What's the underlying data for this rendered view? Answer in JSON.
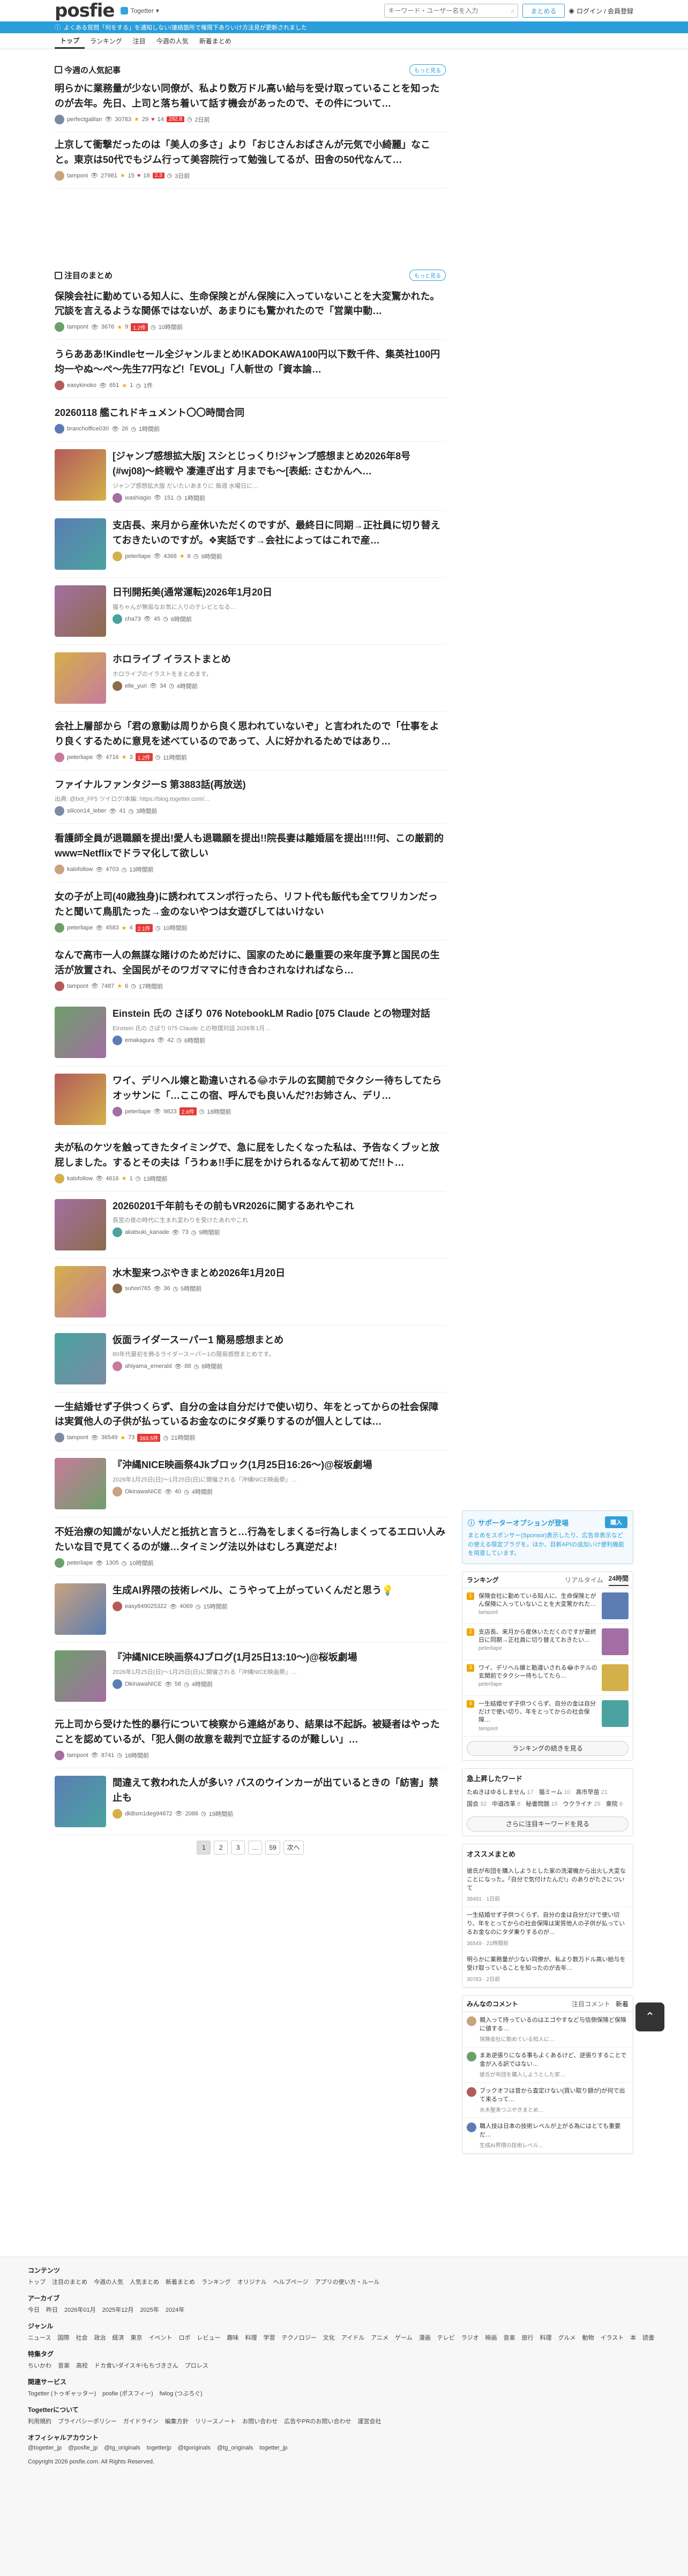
{
  "header": {
    "logo": "posfie",
    "sublogo": "Togetter",
    "search_placeholder": "キーワード・ユーザー名を入力",
    "make_label": "まとめる",
    "login_label": "ログイン / 会員登録"
  },
  "notice": "よくある質問「何をする」を通知しない/連絡箇所で権限下ありいけ方法見が更新されました",
  "tabs": [
    "トップ",
    "ランキング",
    "注目",
    "今週の人気",
    "新着まとめ"
  ],
  "hot": {
    "heading": "今週の人気記事",
    "more": "もっと見る",
    "items": [
      {
        "title": "明らかに業務量が少ない同僚が、私より数万ドル高い給与を受け取っていることを知ったのが去年。先日、上司と落ち着いて話す機会があったので、その件について…",
        "user": "perfectgalilan",
        "views": "30783",
        "stars": "29",
        "hearts": "14",
        "badge": "292.8",
        "comments": "2日前"
      },
      {
        "title": "上京して衝撃だったのは「美人の多さ」より「おじさんおばさんが元気で小綺麗」なこと。東京は50代でもジム行って美容院行って勉強してるが、田舎の50代なんて…",
        "user": "tamponi",
        "views": "27981",
        "stars": "15",
        "hearts": "18",
        "badge": "2.3",
        "comments": "3日前"
      }
    ]
  },
  "featured": {
    "heading": "注目のまとめ",
    "more": "もっと見る",
    "items": [
      {
        "title": "保険会社に勤めている知人に、生命保険とがん保険に入っていないことを大変驚かれた。冗談を言えるような関係ではないが、あまりにも驚かれたので「営業中動…",
        "user": "tampont",
        "views": "3676",
        "stars": "9",
        "badge": "1.2件",
        "comments": "10時間前",
        "thumb": false
      },
      {
        "title": "うらあああ!Kindleセール全ジャンルまとめ!KADOKAWA100円以下数千件、集英社100円均一やぬ〜ぺ〜先生77円など!「EVOL」「人斬世の「資本論…",
        "user": "easykinoko",
        "views": "651",
        "stars": "1",
        "badge": "",
        "comments": "1件",
        "thumb": false
      },
      {
        "title": "20260118 艦これドキュメント〇〇時間合同",
        "user": "branchoffice030",
        "views": "26",
        "stars": "",
        "badge": "",
        "comments": "1時間前",
        "thumb": false
      },
      {
        "title": "[ジャンプ感想拡大版] スシとじっくり!ジャンプ感想まとめ2026年8号(#wj08)〜終戦や 凄連ぎ出す 月までも〜[表紙: さむかんへ…",
        "desc": "ジャンプ感想拡大版 だいたいあまりに 毎週 水曜日に…",
        "user": "washiagio",
        "views": "151",
        "stars": "",
        "badge": "",
        "comments": "1時間前",
        "thumb": true
      },
      {
        "title": "支店長、来月から産休いただくのですが、最終日に同期→正社員に切り替えておきたいのですが。❖実話です→会社によってはこれで産…",
        "user": "peterliape",
        "views": "4368",
        "stars": "6",
        "badge": "",
        "comments": "9時間前",
        "thumb": true
      },
      {
        "title": "日刊開拓美(通常運転)2026年1月20日",
        "desc": "猫ちゃんが無垢なお気に入りのテレビとなる…",
        "user": "cha73",
        "views": "45",
        "stars": "",
        "badge": "",
        "comments": "6時間前",
        "thumb": true
      },
      {
        "title": "ホロライブ イラストまとめ",
        "desc": "ホロライブのイラストをまとめます。",
        "user": "elle_yuri",
        "views": "34",
        "stars": "",
        "badge": "",
        "comments": "4時間前",
        "thumb": true
      },
      {
        "title": "会社上層部から「君の意動は周りから良く思われていないぞ」と言われたので「仕事をより良くするために意見を述べているのであって、人に好かれるためではあり…",
        "user": "peterliape",
        "views": "4716",
        "stars": "3",
        "badge": "1.2件",
        "comments": "11時間前",
        "thumb": false
      },
      {
        "title": "ファイナルファンタジーS 第3883話(再放送)",
        "desc": "出典: @bot_FF5 ツイログ/本編: https://blog.togetter.com/…",
        "user": "silicon14_leber",
        "views": "41",
        "stars": "",
        "badge": "",
        "comments": "3時間前",
        "thumb": false
      },
      {
        "title": "看護師全員が退職願を提出!愛人も退職願を提出!!院長妻は離婚届を提出!!!!何、この厳罰的www=Netflixでドラマ化して欲しい",
        "user": "kalofollow",
        "views": "4703",
        "stars": "",
        "badge": "",
        "comments": "13時間前",
        "thumb": false
      },
      {
        "title": "女の子が上司(40歳独身)に誘われてスンポ行ったら、リフト代も飯代も全てワリカンだったと聞いて鳥肌たった→金のないやつは女遊びしてはいけない",
        "user": "peterliape",
        "views": "4583",
        "stars": "4",
        "badge": "2.1件",
        "comments": "10時間前",
        "thumb": false
      },
      {
        "title": "なんで高市一人の無謀な賭けのためだけに、国家のために最重要の来年度予算と国民の生活が放置され、全国民がそのワガママに付き合わされなければなら…",
        "user": "tampont",
        "views": "7487",
        "stars": "6",
        "badge": "",
        "comments": "17時間前",
        "thumb": false
      },
      {
        "title": "Einstein 氏の さぼり 076 NotebookLM Radio [075 Claude との物理対話",
        "desc": "Einstein 氏の さぼり 075 Claude との物理対話 2026年1月…",
        "user": "emakagura",
        "views": "42",
        "stars": "",
        "badge": "",
        "comments": "6時間前",
        "thumb": true
      },
      {
        "title": "ワイ、デリヘル嬢と勘違いされる😂ホテルの玄関前でタクシー待ちしてたらオッサンに「…ここの宿、呼んでも良いんだ?!お姉さん、デリ…",
        "user": "peterliape",
        "views": "9823",
        "stars": "",
        "badge": "2.6件",
        "comments": "18時間前",
        "thumb": true
      },
      {
        "title": "夫が私のケツを触ってきたタイミングで、急に屁をしたくなった私は、予告なくブッと放屁しました。するとその夫は「うわぁ!!手に屁をかけられるなんて初めてだ!!ト…",
        "user": "kalofollow",
        "views": "4616",
        "stars": "1",
        "badge": "",
        "comments": "13時間前",
        "thumb": false
      },
      {
        "title": "20260201千年前もその前もVR2026に関するあれやこれ",
        "desc": "長宮の夜の時代に生まれ変わりを受けたあれやこれ",
        "user": "akatsuki_kanade",
        "views": "73",
        "stars": "",
        "badge": "",
        "comments": "9時間前",
        "thumb": true
      },
      {
        "title": "水木聖来つぶやきまとめ2026年1月20日",
        "desc": "",
        "user": "suhori765",
        "views": "36",
        "stars": "",
        "badge": "",
        "comments": "5時間前",
        "thumb": true
      },
      {
        "title": "仮面ライダースーパー1 簡易感想まとめ",
        "desc": "80年代最初を飾るライダースーパー1の簡易感想まとめです。",
        "user": "ahiyama_emerald",
        "views": "88",
        "stars": "",
        "badge": "",
        "comments": "8時間前",
        "thumb": true
      },
      {
        "title": "一生結婚せず子供つくらず、自分の金は自分だけで使い切り、年をとってからの社会保障は実質他人の子供が払っているお金なのにタダ乗りするのが個人としては…",
        "user": "tampont",
        "views": "36549",
        "stars": "73",
        "badge": "393.5件",
        "comments": "21時間前",
        "thumb": false
      },
      {
        "title": "『沖縄NICE映画祭4Jkブロック(1月25日16:26〜)@桜坂劇場",
        "desc": "2026年1月25日(日)〜1月25日(日)に開催される「沖縄NICE映画祭」…",
        "user": "OkinawaNICE",
        "views": "40",
        "stars": "",
        "badge": "",
        "comments": "4時間前",
        "thumb": true
      },
      {
        "title": "不妊治療の知識がない人だと抵抗と言うと…行為をしまくる=行為しまくってるエロい人みたいな目で見てくるのが嫌…タイミング法以外はむしろ真逆だよ!",
        "user": "peterliape",
        "views": "1305",
        "stars": "",
        "badge": "",
        "comments": "10時間前",
        "thumb": false
      },
      {
        "title": "生成AI界隈の技術レベル、こうやって上がっていくんだと思う💡",
        "desc": "",
        "user": "easy849025322",
        "views": "4069",
        "stars": "",
        "badge": "",
        "comments": "15時間前",
        "thumb": true
      },
      {
        "title": "『沖縄NICE映画祭4Jブログ(1月25日13:10〜)@桜坂劇場",
        "desc": "2026年1月25日(日)〜1月25日(日)に開催される「沖縄NICE映画祭」…",
        "user": "OkinawaNICE",
        "views": "58",
        "stars": "",
        "badge": "",
        "comments": "4時間前",
        "thumb": true
      },
      {
        "title": "元上司から受けた性的暴行について検察から連絡があり、結果は不起訴。被疑者はやったことを認めているが、「犯人側の故意を裁判で立証するのが難しい」…",
        "user": "tampont",
        "views": "8741",
        "stars": "",
        "badge": "",
        "comments": "18時間前",
        "thumb": false
      },
      {
        "title": "間違えて救われた人が多い? バスのウインカーが出ているときの「紡害」禁止も",
        "desc": "",
        "user": "dkBsm1deg94672",
        "views": "2086",
        "stars": "",
        "badge": "",
        "comments": "19時間前",
        "thumb": true
      }
    ]
  },
  "pager": [
    "1",
    "2",
    "3",
    "…",
    "59",
    "次へ"
  ],
  "sidebar": {
    "sponsor_title": "サポーターオプションが登場",
    "sponsor_join": "購入",
    "sponsor_text": "まとめをスポンサー(Sponsor)表示したり、広告非表示などの使える限定ブラグを。ほか、目新APIの追加いけ便利機能を用意しています。",
    "ranking_label": "ランキング",
    "ranking_tab1": "リアルタイム",
    "ranking_tab2": "24時間",
    "ranking": [
      {
        "n": "1",
        "t": "保険会社に勤めている知人に、生命保険とがん保険に入っていないことを大変驚かれた…",
        "sub": "tampont"
      },
      {
        "n": "2",
        "t": "支店長、来月から産休いただくのですが最終日に同期→正社員に切り替えておきたい…",
        "sub": "peterliape"
      },
      {
        "n": "3",
        "t": "ワイ、デリヘル嬢と勘違いされる😂ホテルの玄関前でタクシー待ちしてたら…",
        "sub": "peterliape"
      },
      {
        "n": "4",
        "t": "一生結婚せず子供つくらず、自分の金は自分だけで使い切り、年をとってからの社会保障…",
        "sub": "tampont"
      }
    ],
    "ranking_more": "ランキングの続きを見る",
    "kw_title": "急上昇したワード",
    "keywords": [
      {
        "w": "たぬきはゆるしません",
        "c": "17"
      },
      {
        "w": "猫ミーム",
        "c": "10"
      },
      {
        "w": "高市早苗",
        "c": "21"
      },
      {
        "w": "国会",
        "c": "32"
      },
      {
        "w": "中道改革",
        "c": "8"
      },
      {
        "w": "秘書問題",
        "c": "15"
      },
      {
        "w": "ウクライナ",
        "c": "25"
      },
      {
        "w": "衆院",
        "c": "9"
      }
    ],
    "kw_more": "さらに注目キーワードを見る",
    "reco_title": "オススメまとめ",
    "recos": [
      {
        "t": "彼氏が布団を購入しようとした家の洗濯機から出火し大変なことになった。「自分で気付けたんだ!」のありがたさについて",
        "sub": "39491 · 1日前"
      },
      {
        "t": "一生結婚せず子供つくらず、自分の金は自分だけで使い切り、年をとってからの社会保障は実質他人の子供が払っているお金なのにタダ乗りするのが…",
        "sub": "36549 · 21時間前"
      },
      {
        "t": "明らかに業務量が少ない同僚が、私より数万ドル高い給与を受け取っていることを知ったのが去年…",
        "sub": "30783 · 2日前"
      }
    ],
    "comment_title": "みんなのコメント",
    "comment_tab1": "注目コメント",
    "comment_tab2": "新着",
    "comments": [
      {
        "t": "親入って持っているのはエゴやすなど与信側保険ど保険に値する…",
        "sub": "保険会社に勤めている知人に…"
      },
      {
        "t": "まあ逆張りになる事もよくあるけど、逆張りすることで金が入る訳ではない…",
        "sub": "彼氏が布団を購入しようとした家…"
      },
      {
        "t": "ブックオフは昔から査定けない(買い取り額が)が何で出て来るって…",
        "sub": "水木聖来つぶやきまとめ…"
      },
      {
        "t": "職人技は日本の技術レベルが上がる為にはとても重要だ…",
        "sub": "生成AI界隈の技術レベル…"
      }
    ]
  },
  "footer": {
    "sections": [
      {
        "h": "コンテンツ",
        "links": [
          "トップ",
          "注目のまとめ",
          "今週の人気",
          "人気まとめ",
          "新着まとめ",
          "ランキング",
          "オリジナル",
          "ヘルプページ",
          "アプリの使い方・ルール"
        ]
      },
      {
        "h": "アーカイブ",
        "links": [
          "今日",
          "昨日",
          "2026年01月",
          "2025年12月",
          "2025年",
          "2024年"
        ]
      },
      {
        "h": "ジャンル",
        "links": [
          "ニュース",
          "国際",
          "社会",
          "政治",
          "経済",
          "東京",
          "イベント",
          "ロボ",
          "レビュー",
          "趣味",
          "料理",
          "学習",
          "テクノロジー",
          "文化",
          "アイドル",
          "アニメ",
          "ゲーム",
          "漫画",
          "テレビ",
          "ラジオ",
          "映画",
          "音楽",
          "旅行",
          "料理",
          "グルメ",
          "動物",
          "イラスト",
          "本",
          "読書"
        ]
      },
      {
        "h": "特集タグ",
        "links": [
          "ちいかわ",
          "音楽",
          "高校",
          "ドカ食いダイスキ!もちづきさん",
          "プロレス"
        ]
      },
      {
        "h": "関連サービス",
        "links": [
          "Togetter (トゥギャッター)",
          "posfie (ポスフィー)",
          "fwlog (つぶろぐ)"
        ]
      },
      {
        "h": "Togetterについて",
        "links": [
          "利用規約",
          "プライバシーポリシー",
          "ガイドライン",
          "編集方針",
          "リリースノート",
          "お問い合わせ",
          "広告やPRのお問い合わせ",
          "運営会社"
        ]
      },
      {
        "h": "オフィシャルアカウント",
        "links": [
          "@togetter_jp",
          "@posfie_jp",
          "@tg_originals",
          "togetterjp",
          "@tgoriginals",
          "@tg_originals",
          "togetter_jp"
        ]
      }
    ],
    "copyright": "Copyright 2026 posfie.com. All Rights Reserved."
  },
  "colors": {
    "accent": "#2f9fd8",
    "brand_dot": "#8bc34a",
    "star": "#f0a500",
    "heart": "#e53935"
  }
}
